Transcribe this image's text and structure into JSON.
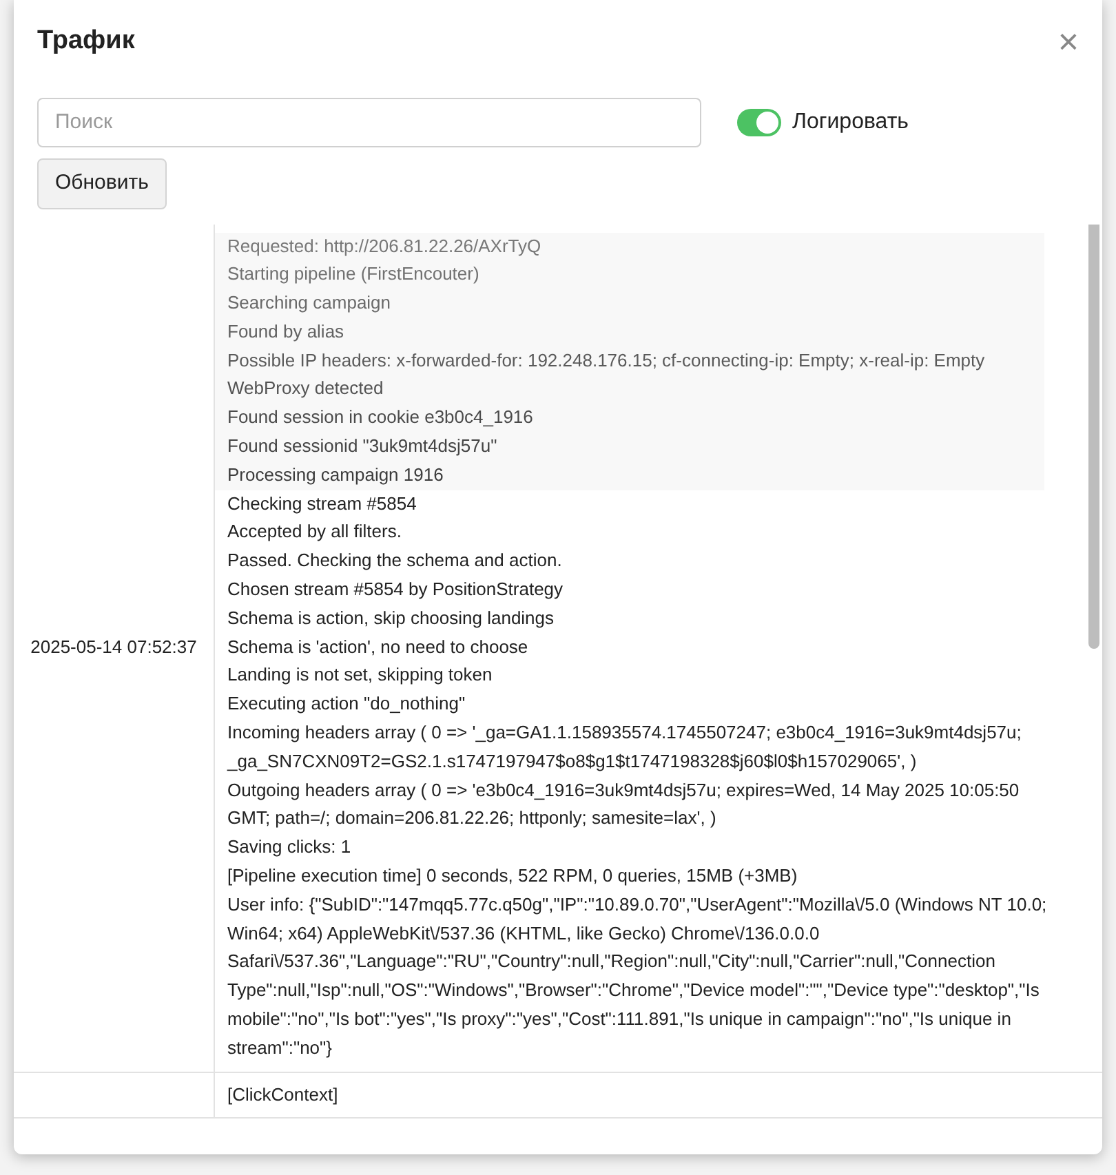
{
  "dialog": {
    "title": "Трафик",
    "close": "×"
  },
  "search": {
    "placeholder": "Поиск"
  },
  "logging_toggle": {
    "label": "Логировать",
    "on": true
  },
  "refresh_button": "Обновить",
  "rows": [
    {
      "time": "2025-05-14 07:52:37",
      "faded_lines": [
        "Requested: http://206.81.22.26/AXrTyQ",
        "Starting pipeline (FirstEncouter)",
        "Searching campaign",
        "Found by alias",
        "Possible IP headers: x-forwarded-for: 192.248.176.15; cf-connecting-ip: Empty; x-real-ip: Empty",
        "WebProxy detected",
        "Found session in cookie e3b0c4_1916",
        "Found sessionid \"3uk9mt4dsj57u\"",
        "Processing campaign 1916"
      ],
      "lines": [
        "Checking stream #5854",
        "Accepted by all filters.",
        "Passed. Checking the schema and action.",
        "Chosen stream #5854 by PositionStrategy",
        "Schema is action, skip choosing landings",
        "Schema is 'action', no need to choose",
        "Landing is not set, skipping token",
        "Executing action \"do_nothing\"",
        "Incoming headers array ( 0 => '_ga=GA1.1.158935574.1745507247; e3b0c4_1916=3uk9mt4dsj57u; _ga_SN7CXN09T2=GS2.1.s1747197947$o8$g1$t1747198328$j60$l0$h157029065', )",
        "Outgoing headers array ( 0 => 'e3b0c4_1916=3uk9mt4dsj57u; expires=Wed, 14 May 2025 10:05:50 GMT; path=/; domain=206.81.22.26; httponly; samesite=lax', )",
        "Saving clicks: 1",
        "[Pipeline execution time] 0 seconds, 522 RPM, 0 queries, 15MB (+3MB)",
        "User info: {\"SubID\":\"147mqq5.77c.q50g\",\"IP\":\"10.89.0.70\",\"UserAgent\":\"Mozilla\\/5.0 (Windows NT 10.0; Win64; x64) AppleWebKit\\/537.36 (KHTML, like Gecko) Chrome\\/136.0.0.0 Safari\\/537.36\",\"Language\":\"RU\",\"Country\":null,\"Region\":null,\"City\":null,\"Carrier\":null,\"Connection Type\":null,\"Isp\":null,\"OS\":\"Windows\",\"Browser\":\"Chrome\",\"Device model\":\"\",\"Device type\":\"desktop\",\"Is mobile\":\"no\",\"Is bot\":\"yes\",\"Is proxy\":\"yes\",\"Cost\":111.891,\"Is unique in campaign\":\"no\",\"Is unique in stream\":\"no\"}"
      ]
    },
    {
      "lines": [
        "[ClickContext]"
      ]
    }
  ]
}
